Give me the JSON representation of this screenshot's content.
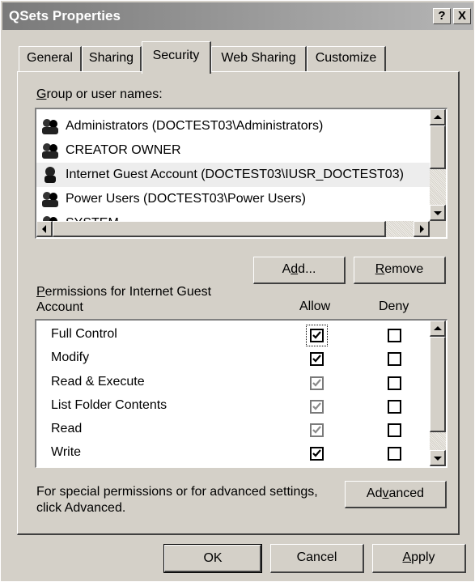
{
  "window": {
    "title": "QSets Properties",
    "help_label": "?",
    "close_label": "X"
  },
  "tabs": [
    {
      "label": "General"
    },
    {
      "label": "Sharing"
    },
    {
      "label": "Security"
    },
    {
      "label": "Web Sharing"
    },
    {
      "label": "Customize"
    }
  ],
  "groups": {
    "label_first": "G",
    "label_rest": "roup or user names:",
    "items": [
      {
        "label": "Administrators (DOCTEST03\\Administrators)",
        "icon": "group-icon"
      },
      {
        "label": "CREATOR OWNER",
        "icon": "group-icon"
      },
      {
        "label": "Internet Guest Account (DOCTEST03\\IUSR_DOCTEST03)",
        "icon": "user-icon",
        "selected": true
      },
      {
        "label": "Power Users (DOCTEST03\\Power Users)",
        "icon": "group-icon"
      },
      {
        "label": "SYSTEM",
        "icon": "group-icon"
      }
    ]
  },
  "buttons": {
    "add_pre": "A",
    "add_mid": "d",
    "add_post": "d...",
    "remove_first": "R",
    "remove_rest": "emove",
    "advanced_pre": "Ad",
    "advanced_mid": "v",
    "advanced_post": "anced",
    "ok": "OK",
    "cancel": "Cancel",
    "apply_first": "A",
    "apply_rest": "pply"
  },
  "permissions": {
    "label_first": "P",
    "label_line1_rest": "ermissions for Internet Guest",
    "label_line2": "Account",
    "allow_header": "Allow",
    "deny_header": "Deny",
    "rows": [
      {
        "name": "Full Control",
        "allow": "checked",
        "deny": "unchecked"
      },
      {
        "name": "Modify",
        "allow": "checked",
        "deny": "unchecked"
      },
      {
        "name": "Read & Execute",
        "allow": "checked-disabled",
        "deny": "unchecked"
      },
      {
        "name": "List Folder Contents",
        "allow": "checked-disabled",
        "deny": "unchecked"
      },
      {
        "name": "Read",
        "allow": "checked-disabled",
        "deny": "unchecked"
      },
      {
        "name": "Write",
        "allow": "checked",
        "deny": "unchecked"
      }
    ]
  },
  "advanced_note": {
    "line1": "For special permissions or for advanced settings,",
    "line2": "click Advanced."
  }
}
